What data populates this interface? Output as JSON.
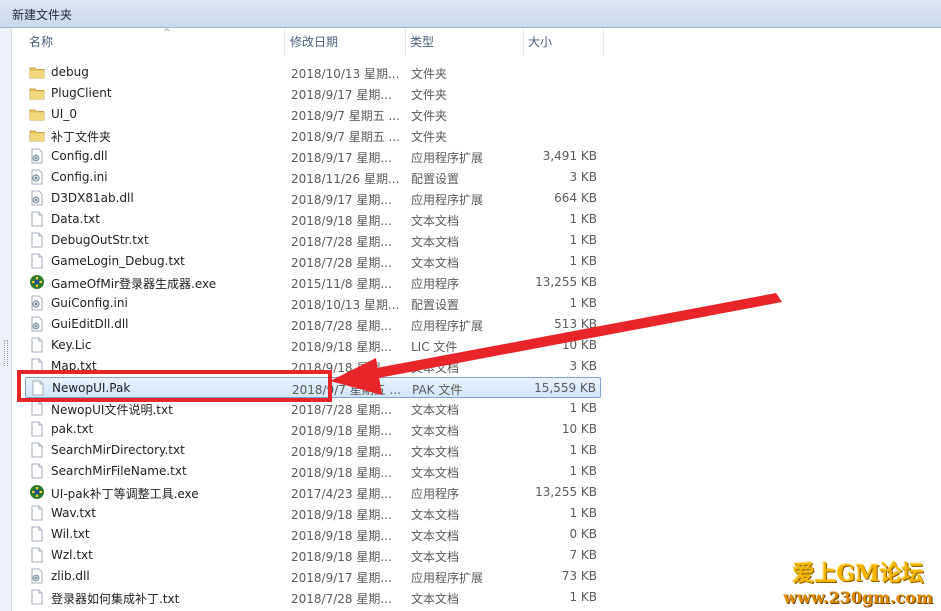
{
  "window": {
    "title": "新建文件夹"
  },
  "columns": {
    "name": "名称",
    "date": "修改日期",
    "type": "类型",
    "size": "大小",
    "sort_indicator": "^"
  },
  "colors": {
    "selection_bg": "#cfe6fb",
    "selection_border": "#7da2ce",
    "annotation_red": "#e8262a",
    "folder": "#e8c25a"
  },
  "files": [
    {
      "name": "debug",
      "date": "2018/10/13 星期...",
      "type": "文件夹",
      "size": "",
      "icon": "folder-icon"
    },
    {
      "name": "PlugClient",
      "date": "2018/9/17 星期...",
      "type": "文件夹",
      "size": "",
      "icon": "folder-icon"
    },
    {
      "name": "UI_0",
      "date": "2018/9/7 星期五 ...",
      "type": "文件夹",
      "size": "",
      "icon": "folder-icon"
    },
    {
      "name": "补丁文件夹",
      "date": "2018/9/7 星期五 ...",
      "type": "文件夹",
      "size": "",
      "icon": "folder-icon"
    },
    {
      "name": "Config.dll",
      "date": "2018/9/17 星期...",
      "type": "应用程序扩展",
      "size": "3,491 KB",
      "icon": "dll-icon"
    },
    {
      "name": "Config.ini",
      "date": "2018/11/26 星期...",
      "type": "配置设置",
      "size": "3 KB",
      "icon": "ini-icon"
    },
    {
      "name": "D3DX81ab.dll",
      "date": "2018/9/17 星期...",
      "type": "应用程序扩展",
      "size": "664 KB",
      "icon": "dll-icon"
    },
    {
      "name": "Data.txt",
      "date": "2018/9/18 星期...",
      "type": "文本文档",
      "size": "1 KB",
      "icon": "text-file-icon"
    },
    {
      "name": "DebugOutStr.txt",
      "date": "2018/7/28 星期...",
      "type": "文本文档",
      "size": "1 KB",
      "icon": "text-file-icon"
    },
    {
      "name": "GameLogin_Debug.txt",
      "date": "2018/7/28 星期...",
      "type": "文本文档",
      "size": "1 KB",
      "icon": "text-file-icon"
    },
    {
      "name": "GameOfMir登录器生成器.exe",
      "date": "2015/11/8 星期...",
      "type": "应用程序",
      "size": "13,255 KB",
      "icon": "app-exe-icon"
    },
    {
      "name": "GuiConfig.ini",
      "date": "2018/10/13 星期...",
      "type": "配置设置",
      "size": "1 KB",
      "icon": "ini-icon"
    },
    {
      "name": "GuiEditDll.dll",
      "date": "2018/7/28 星期...",
      "type": "应用程序扩展",
      "size": "513 KB",
      "icon": "dll-icon"
    },
    {
      "name": "Key.Lic",
      "date": "2018/9/18 星期...",
      "type": "LIC 文件",
      "size": "10 KB",
      "icon": "blank-file-icon"
    },
    {
      "name": "Map.txt",
      "date": "2018/9/18 星期...",
      "type": "文本文档",
      "size": "3 KB",
      "icon": "text-file-icon"
    },
    {
      "name": "NewopUI.Pak",
      "date": "2018/9/7 星期五 ...",
      "type": "PAK 文件",
      "size": "15,559 KB",
      "icon": "blank-file-icon",
      "selected": true
    },
    {
      "name": "NewopUI文件说明.txt",
      "date": "2018/7/28 星期...",
      "type": "文本文档",
      "size": "1 KB",
      "icon": "text-file-icon"
    },
    {
      "name": "pak.txt",
      "date": "2018/9/18 星期...",
      "type": "文本文档",
      "size": "10 KB",
      "icon": "text-file-icon"
    },
    {
      "name": "SearchMirDirectory.txt",
      "date": "2018/9/18 星期...",
      "type": "文本文档",
      "size": "1 KB",
      "icon": "text-file-icon"
    },
    {
      "name": "SearchMirFileName.txt",
      "date": "2018/9/18 星期...",
      "type": "文本文档",
      "size": "1 KB",
      "icon": "text-file-icon"
    },
    {
      "name": "UI-pak补丁等调整工具.exe",
      "date": "2017/4/23 星期...",
      "type": "应用程序",
      "size": "13,255 KB",
      "icon": "app-exe-icon"
    },
    {
      "name": "Wav.txt",
      "date": "2018/9/18 星期...",
      "type": "文本文档",
      "size": "1 KB",
      "icon": "text-file-icon"
    },
    {
      "name": "Wil.txt",
      "date": "2018/9/18 星期...",
      "type": "文本文档",
      "size": "0 KB",
      "icon": "text-file-icon"
    },
    {
      "name": "Wzl.txt",
      "date": "2018/9/18 星期...",
      "type": "文本文档",
      "size": "7 KB",
      "icon": "text-file-icon"
    },
    {
      "name": "zlib.dll",
      "date": "2018/9/17 星期...",
      "type": "应用程序扩展",
      "size": "73 KB",
      "icon": "dll-icon"
    },
    {
      "name": "登录器如何集成补丁.txt",
      "date": "2018/7/28 星期...",
      "type": "文本文档",
      "size": "1 KB",
      "icon": "text-file-icon"
    }
  ],
  "watermark": {
    "line1": "爱上GM论坛",
    "line2": "www.230gm.com"
  }
}
